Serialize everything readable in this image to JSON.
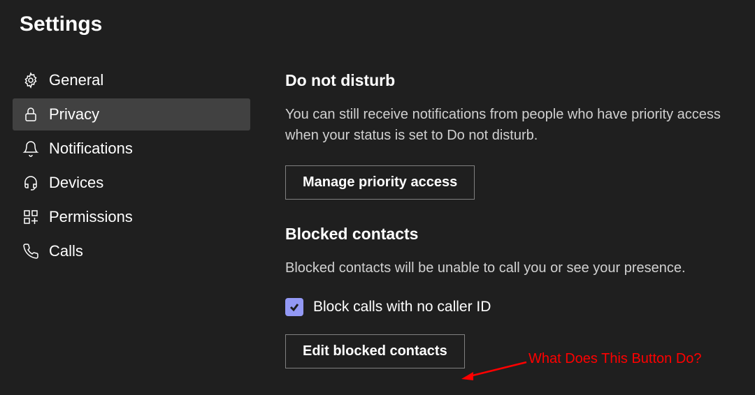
{
  "window": {
    "title": "Settings"
  },
  "sidebar": {
    "items": [
      {
        "label": "General",
        "icon": "gear-icon"
      },
      {
        "label": "Privacy",
        "icon": "lock-icon",
        "active": true
      },
      {
        "label": "Notifications",
        "icon": "bell-icon"
      },
      {
        "label": "Devices",
        "icon": "headset-icon"
      },
      {
        "label": "Permissions",
        "icon": "apps-icon"
      },
      {
        "label": "Calls",
        "icon": "phone-icon"
      }
    ]
  },
  "content": {
    "sections": [
      {
        "title": "Do not disturb",
        "desc": "You can still receive notifications from people who have priority access when your status is set to Do not disturb.",
        "button": "Manage priority access"
      },
      {
        "title": "Blocked contacts",
        "desc": "Blocked contacts will be unable to call you or see your presence.",
        "checkbox": {
          "checked": true,
          "label": "Block calls with no caller ID"
        },
        "button": "Edit blocked contacts"
      }
    ]
  },
  "annotation": {
    "text": "What Does This Button Do?"
  }
}
